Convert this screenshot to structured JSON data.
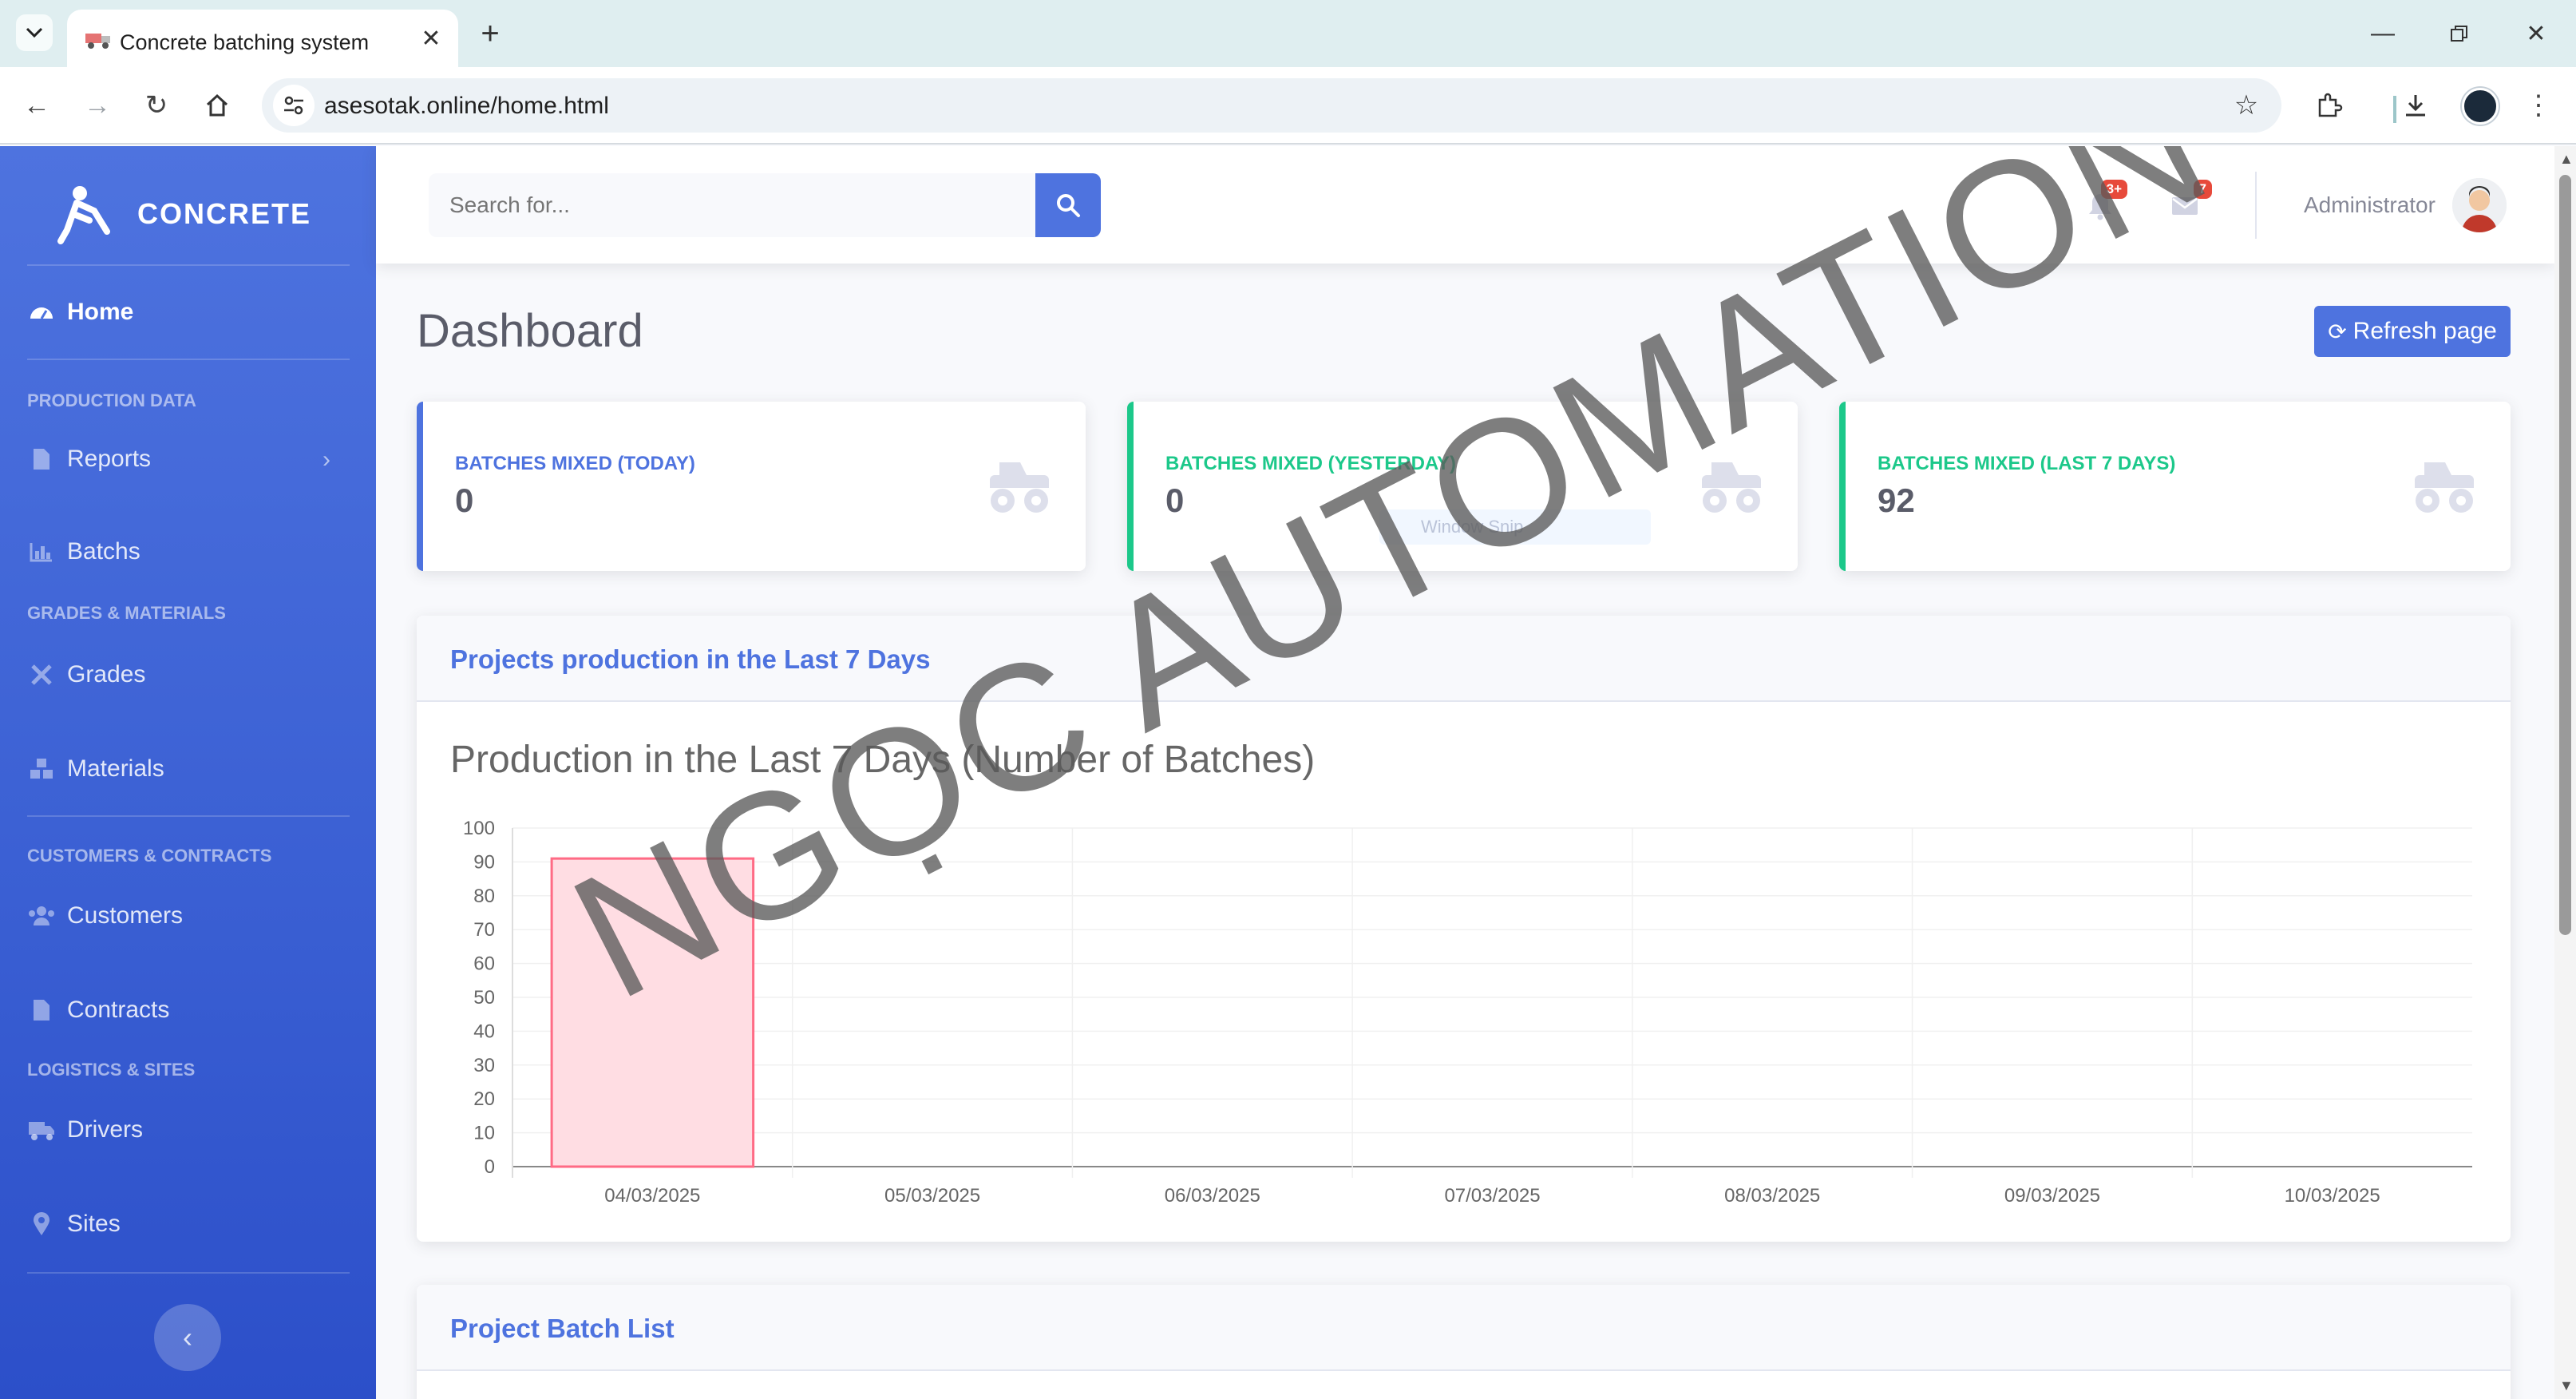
{
  "browser": {
    "tab_title": "Concrete batching system",
    "url": "asesotak.online/home.html"
  },
  "sidebar": {
    "brand": "CONCRETE",
    "home": "Home",
    "headings": {
      "production": "PRODUCTION DATA",
      "grades": "GRADES & MATERIALS",
      "customers": "CUSTOMERS & CONTRACTS",
      "logistics": "LOGISTICS & SITES"
    },
    "items": {
      "reports": "Reports",
      "batchs": "Batchs",
      "grades": "Grades",
      "materials": "Materials",
      "customers": "Customers",
      "contracts": "Contracts",
      "drivers": "Drivers",
      "sites": "Sites"
    }
  },
  "topbar": {
    "search_placeholder": "Search for...",
    "alerts_badge": "3+",
    "messages_badge": "7",
    "user_name": "Administrator"
  },
  "main": {
    "page_title": "Dashboard",
    "refresh_label": "Refresh page",
    "cards": [
      {
        "label": "BATCHES MIXED (TODAY)",
        "value": "0",
        "color": "#4e73df"
      },
      {
        "label": "BATCHES MIXED (YESTERDAY)",
        "value": "0",
        "color": "#1cc88a"
      },
      {
        "label": "BATCHES MIXED (LAST 7 DAYS)",
        "value": "92",
        "color": "#1cc88a"
      }
    ],
    "chart_panel_title": "Projects production in the Last 7 Days",
    "batch_list_title": "Project Batch List",
    "ghost_tooltip": "Window Snip"
  },
  "watermark": "NGỌC AUTOMATION",
  "colors": {
    "primary": "#4e73df",
    "success": "#1cc88a",
    "danger": "#e74a3b",
    "bar_fill": "#ffdde3",
    "bar_stroke": "#ff6b85"
  },
  "chart_data": {
    "type": "bar",
    "title": "Production in the Last 7 Days (Number of Batches)",
    "categories": [
      "04/03/2025",
      "05/03/2025",
      "06/03/2025",
      "07/03/2025",
      "08/03/2025",
      "09/03/2025",
      "10/03/2025"
    ],
    "values": [
      91,
      0,
      0,
      0,
      0,
      0,
      0
    ],
    "ylim": [
      0,
      100
    ],
    "yticks": [
      0,
      10,
      20,
      30,
      40,
      50,
      60,
      70,
      80,
      90,
      100
    ],
    "grid": true,
    "legend": "none"
  }
}
